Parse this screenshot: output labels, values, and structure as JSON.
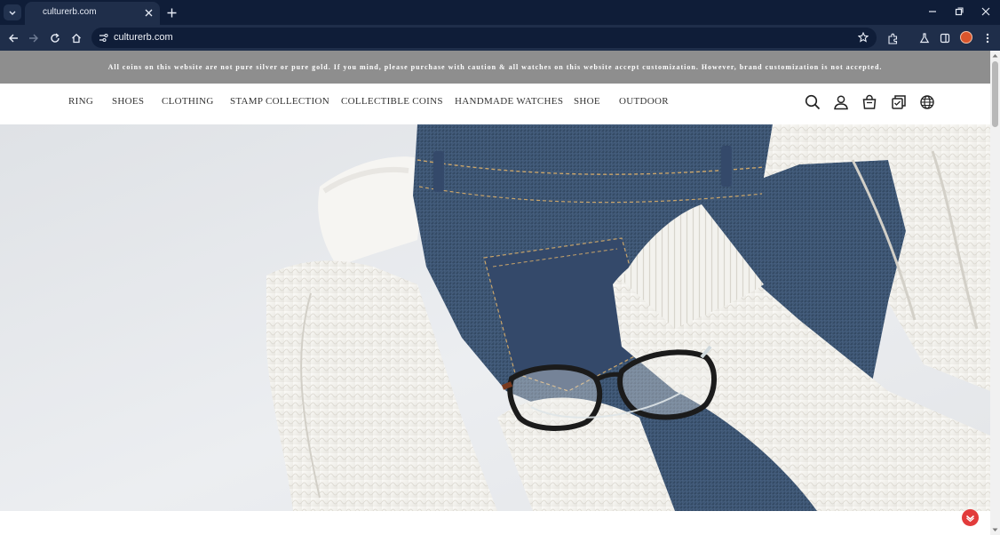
{
  "browser": {
    "tab_title": "culturerb.com",
    "url": "culturerb.com",
    "icons": [
      "tab-search-icon",
      "close-icon",
      "plus-icon",
      "minimize-icon",
      "restore-icon",
      "close-window-icon",
      "back-icon",
      "forward-icon",
      "reload-icon",
      "home-icon",
      "site-info-icon",
      "star-icon",
      "extensions-icon",
      "lab-icon",
      "sidepanel-icon",
      "profile-avatar",
      "kebab-menu-icon"
    ]
  },
  "announcement": {
    "text": "All coins on this website are not pure silver or pure gold. If you mind, please purchase with caution & all watches on this website accept customization. However, brand customization is not accepted."
  },
  "nav": {
    "items": [
      {
        "label": "RING"
      },
      {
        "label": "SHOES"
      },
      {
        "label": "CLOTHING"
      },
      {
        "label": "STAMP COLLECTION"
      },
      {
        "label": "COLLECTIBLE COINS"
      },
      {
        "label": "HANDMADE WATCHES"
      },
      {
        "label": "SHOE"
      },
      {
        "label": "OUTDOOR"
      }
    ],
    "icons": [
      "search-icon",
      "account-icon",
      "cart-icon",
      "catalog-icon",
      "globe-icon"
    ]
  },
  "hero": {
    "image": "flat lay of a white knit sweater, blue denim jeans and black-framed eyeglasses",
    "colors": {
      "background": "#e9ebee",
      "denim": "#3d5676",
      "knit": "#f4f3ef",
      "frames": "#1b1b1b"
    }
  },
  "colors": {
    "chrome_dark": "#0f1d38",
    "chrome": "#1f2e4a",
    "announcement_bar": "#8e8e8e",
    "nav_text": "#333333",
    "chat_widget": "#e23b3b"
  }
}
